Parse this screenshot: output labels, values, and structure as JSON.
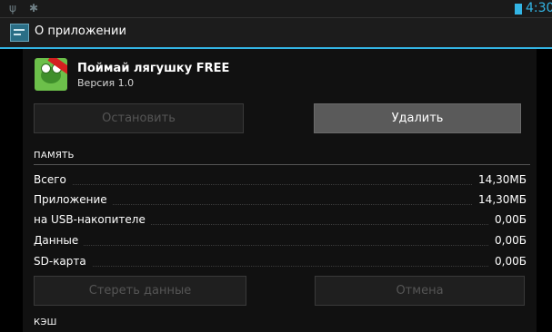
{
  "status_bar": {
    "usb_icon": "usb-icon",
    "tools_icon": "tools-icon",
    "battery_icon": "battery-icon",
    "time": "4:30",
    "accent_color": "#33b5e5"
  },
  "action_bar": {
    "icon": "settings-app-icon",
    "title": "О приложении"
  },
  "app": {
    "icon": "frog-app-icon",
    "name": "Поймай лягушку FREE",
    "version": "Версия 1.0"
  },
  "buttons": {
    "stop": "Остановить",
    "delete": "Удалить",
    "clear_data": "Стереть данные",
    "cancel": "Отмена"
  },
  "memory": {
    "header": "ПАМЯТЬ",
    "rows": [
      {
        "label": "Всего",
        "value": "14,30МБ"
      },
      {
        "label": "Приложение",
        "value": "14,30МБ"
      },
      {
        "label": "на USB-накопителе",
        "value": "0,00Б"
      },
      {
        "label": "Данные",
        "value": "0,00Б"
      },
      {
        "label": "SD-карта",
        "value": "0,00Б"
      }
    ]
  },
  "cache": {
    "header": "КЭШ"
  }
}
